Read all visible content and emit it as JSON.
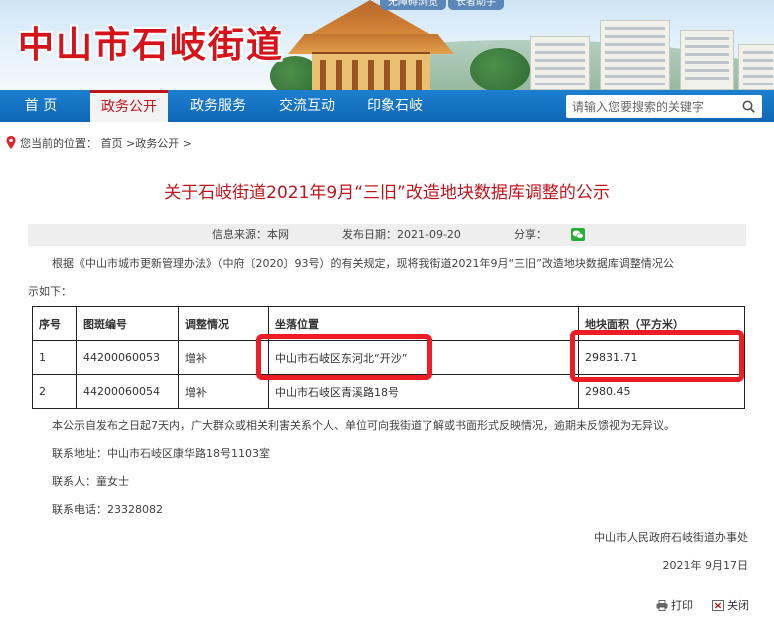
{
  "header": {
    "site_title": "中山市石岐街道",
    "top_badges": [
      "无障碍浏览",
      "长者助手"
    ]
  },
  "nav": {
    "items": [
      "首 页",
      "政务公开",
      "政务服务",
      "交流互动",
      "印象石岐"
    ],
    "active_index": 1,
    "search_placeholder": "请输入您要搜索的关键字"
  },
  "breadcrumb": {
    "label": "您当前的位置：",
    "home": "首页",
    "sep": ">",
    "section": "政务公开",
    "trail": ">"
  },
  "article": {
    "title": "关于石岐街道2021年9月“三旧”改造地块数据库调整的公示",
    "source_label": "信息来源：",
    "source": "本网",
    "date_label": "发布日期：",
    "date": "2021-09-20",
    "share_label": "分享：",
    "intro_line1": "根据《中山市城市更新管理办法》（中府〔2020〕93号）的有关规定，现将我街道2021年9月“三旧”改造地块数据库调整情况公",
    "intro_line2": "示如下：",
    "table": {
      "headers": [
        "序号",
        "图斑编号",
        "调整情况",
        "坐落位置",
        "地块面积（平方米）"
      ],
      "rows": [
        [
          "1",
          "44200060053",
          "增补",
          "中山市石岐区东河北“开沙”",
          "29831.71"
        ],
        [
          "2",
          "44200060054",
          "增补",
          "中山市石岐区青溪路18号",
          "2980.45"
        ]
      ]
    },
    "notice": "本公示自发布之日起7天内，广大群众或相关利害关系个人、单位可向我街道了解或书面形式反映情况，逾期未反馈视为无异议。",
    "address": "联系地址：中山市石岐区康华路18号1103室",
    "contact": "联系人：童女士",
    "phone": "联系电话：23328082",
    "signature": "中山市人民政府石岐街道办事处",
    "sign_date": "2021年 9月17日"
  },
  "footer": {
    "print": "打印",
    "close": "关闭"
  },
  "colors": {
    "title_red": "#c0141c",
    "nav_blue": "#1470c2",
    "highlight_red": "#ee1c25"
  }
}
